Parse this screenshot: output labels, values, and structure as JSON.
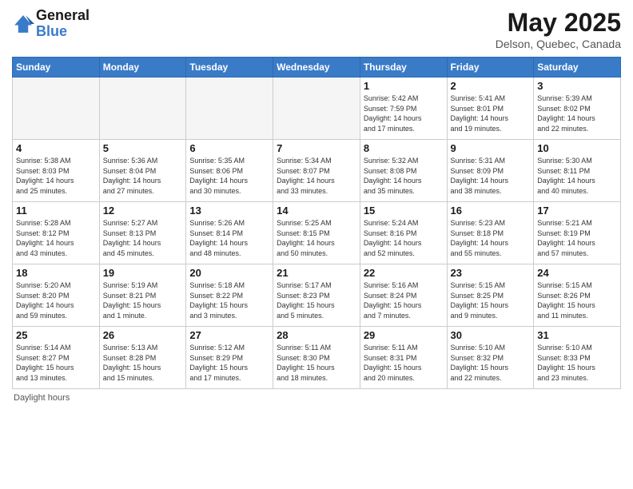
{
  "header": {
    "logo_line1": "General",
    "logo_line2": "Blue",
    "month_title": "May 2025",
    "location": "Delson, Quebec, Canada"
  },
  "weekdays": [
    "Sunday",
    "Monday",
    "Tuesday",
    "Wednesday",
    "Thursday",
    "Friday",
    "Saturday"
  ],
  "weeks": [
    [
      {
        "day": "",
        "info": ""
      },
      {
        "day": "",
        "info": ""
      },
      {
        "day": "",
        "info": ""
      },
      {
        "day": "",
        "info": ""
      },
      {
        "day": "1",
        "info": "Sunrise: 5:42 AM\nSunset: 7:59 PM\nDaylight: 14 hours\nand 17 minutes."
      },
      {
        "day": "2",
        "info": "Sunrise: 5:41 AM\nSunset: 8:01 PM\nDaylight: 14 hours\nand 19 minutes."
      },
      {
        "day": "3",
        "info": "Sunrise: 5:39 AM\nSunset: 8:02 PM\nDaylight: 14 hours\nand 22 minutes."
      }
    ],
    [
      {
        "day": "4",
        "info": "Sunrise: 5:38 AM\nSunset: 8:03 PM\nDaylight: 14 hours\nand 25 minutes."
      },
      {
        "day": "5",
        "info": "Sunrise: 5:36 AM\nSunset: 8:04 PM\nDaylight: 14 hours\nand 27 minutes."
      },
      {
        "day": "6",
        "info": "Sunrise: 5:35 AM\nSunset: 8:06 PM\nDaylight: 14 hours\nand 30 minutes."
      },
      {
        "day": "7",
        "info": "Sunrise: 5:34 AM\nSunset: 8:07 PM\nDaylight: 14 hours\nand 33 minutes."
      },
      {
        "day": "8",
        "info": "Sunrise: 5:32 AM\nSunset: 8:08 PM\nDaylight: 14 hours\nand 35 minutes."
      },
      {
        "day": "9",
        "info": "Sunrise: 5:31 AM\nSunset: 8:09 PM\nDaylight: 14 hours\nand 38 minutes."
      },
      {
        "day": "10",
        "info": "Sunrise: 5:30 AM\nSunset: 8:11 PM\nDaylight: 14 hours\nand 40 minutes."
      }
    ],
    [
      {
        "day": "11",
        "info": "Sunrise: 5:28 AM\nSunset: 8:12 PM\nDaylight: 14 hours\nand 43 minutes."
      },
      {
        "day": "12",
        "info": "Sunrise: 5:27 AM\nSunset: 8:13 PM\nDaylight: 14 hours\nand 45 minutes."
      },
      {
        "day": "13",
        "info": "Sunrise: 5:26 AM\nSunset: 8:14 PM\nDaylight: 14 hours\nand 48 minutes."
      },
      {
        "day": "14",
        "info": "Sunrise: 5:25 AM\nSunset: 8:15 PM\nDaylight: 14 hours\nand 50 minutes."
      },
      {
        "day": "15",
        "info": "Sunrise: 5:24 AM\nSunset: 8:16 PM\nDaylight: 14 hours\nand 52 minutes."
      },
      {
        "day": "16",
        "info": "Sunrise: 5:23 AM\nSunset: 8:18 PM\nDaylight: 14 hours\nand 55 minutes."
      },
      {
        "day": "17",
        "info": "Sunrise: 5:21 AM\nSunset: 8:19 PM\nDaylight: 14 hours\nand 57 minutes."
      }
    ],
    [
      {
        "day": "18",
        "info": "Sunrise: 5:20 AM\nSunset: 8:20 PM\nDaylight: 14 hours\nand 59 minutes."
      },
      {
        "day": "19",
        "info": "Sunrise: 5:19 AM\nSunset: 8:21 PM\nDaylight: 15 hours\nand 1 minute."
      },
      {
        "day": "20",
        "info": "Sunrise: 5:18 AM\nSunset: 8:22 PM\nDaylight: 15 hours\nand 3 minutes."
      },
      {
        "day": "21",
        "info": "Sunrise: 5:17 AM\nSunset: 8:23 PM\nDaylight: 15 hours\nand 5 minutes."
      },
      {
        "day": "22",
        "info": "Sunrise: 5:16 AM\nSunset: 8:24 PM\nDaylight: 15 hours\nand 7 minutes."
      },
      {
        "day": "23",
        "info": "Sunrise: 5:15 AM\nSunset: 8:25 PM\nDaylight: 15 hours\nand 9 minutes."
      },
      {
        "day": "24",
        "info": "Sunrise: 5:15 AM\nSunset: 8:26 PM\nDaylight: 15 hours\nand 11 minutes."
      }
    ],
    [
      {
        "day": "25",
        "info": "Sunrise: 5:14 AM\nSunset: 8:27 PM\nDaylight: 15 hours\nand 13 minutes."
      },
      {
        "day": "26",
        "info": "Sunrise: 5:13 AM\nSunset: 8:28 PM\nDaylight: 15 hours\nand 15 minutes."
      },
      {
        "day": "27",
        "info": "Sunrise: 5:12 AM\nSunset: 8:29 PM\nDaylight: 15 hours\nand 17 minutes."
      },
      {
        "day": "28",
        "info": "Sunrise: 5:11 AM\nSunset: 8:30 PM\nDaylight: 15 hours\nand 18 minutes."
      },
      {
        "day": "29",
        "info": "Sunrise: 5:11 AM\nSunset: 8:31 PM\nDaylight: 15 hours\nand 20 minutes."
      },
      {
        "day": "30",
        "info": "Sunrise: 5:10 AM\nSunset: 8:32 PM\nDaylight: 15 hours\nand 22 minutes."
      },
      {
        "day": "31",
        "info": "Sunrise: 5:10 AM\nSunset: 8:33 PM\nDaylight: 15 hours\nand 23 minutes."
      }
    ]
  ],
  "footer": {
    "daylight_label": "Daylight hours"
  },
  "colors": {
    "header_bg": "#3a7bc8",
    "brand_blue": "#3a7bc8"
  }
}
